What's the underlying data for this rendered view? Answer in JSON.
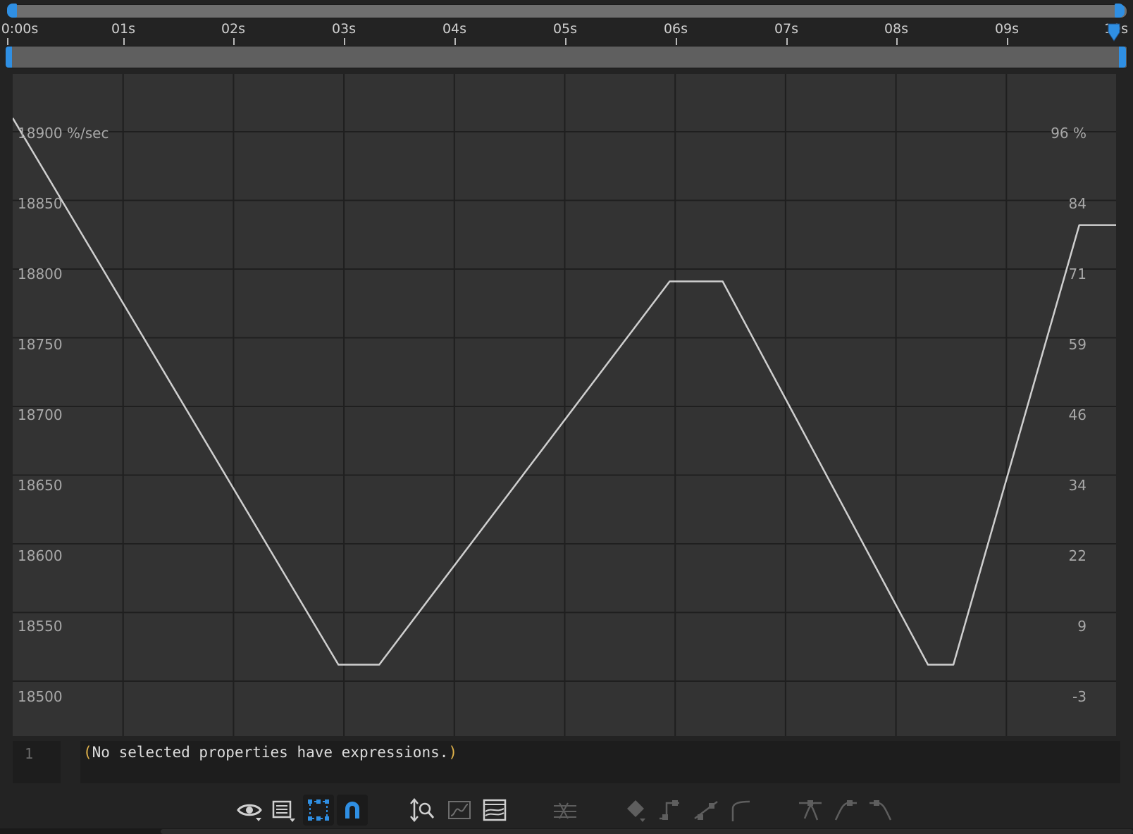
{
  "ruler": {
    "time_labels": [
      "0:00s",
      "01s",
      "02s",
      "03s",
      "04s",
      "05s",
      "06s",
      "07s",
      "08s",
      "09s",
      "10s"
    ]
  },
  "graph": {
    "left_axis": {
      "unit_label": "18900 %/sec",
      "labels": [
        "18850",
        "18800",
        "18750",
        "18700",
        "18650",
        "18600",
        "18550",
        "18500"
      ]
    },
    "right_axis": {
      "unit_label": "96 %",
      "labels": [
        "84",
        "71",
        "59",
        "46",
        "34",
        "22",
        "9",
        "-3"
      ]
    },
    "curve_color": "#cfcfcf",
    "grid_color": "#1f1f1f",
    "playhead_color": "#3a8fe0",
    "curve_keyframes_seconds": [
      {
        "t": 0.0,
        "value_pct_sec": 18910
      },
      {
        "t": 2.95,
        "value_pct_sec": 18512
      },
      {
        "t": 3.32,
        "value_pct_sec": 18512
      },
      {
        "t": 5.95,
        "value_pct_sec": 18791
      },
      {
        "t": 6.43,
        "value_pct_sec": 18791
      },
      {
        "t": 8.29,
        "value_pct_sec": 18512
      },
      {
        "t": 8.52,
        "value_pct_sec": 18512
      },
      {
        "t": 9.66,
        "value_pct_sec": 18832
      },
      {
        "t": 10.0,
        "value_pct_sec": 18832
      }
    ]
  },
  "expression": {
    "line_number": "1",
    "open_paren": "(",
    "text": "No selected properties have expressions.",
    "close_paren": ")"
  },
  "toolbar": {
    "icons": [
      "eye-icon",
      "graph-menu-icon",
      "transform-box-icon",
      "snap-magnet-icon",
      "fit-to-view-icon",
      "fit-selection-icon",
      "fit-all-graphs-icon",
      "separate-dimensions-icon",
      "edit-keyframe-icon",
      "hold-keyframe-icon",
      "linear-keyframe-icon",
      "auto-bezier-icon",
      "easy-ease-icon",
      "easy-ease-in-icon",
      "easy-ease-out-icon"
    ],
    "accent_color": "#2f8fe3"
  }
}
